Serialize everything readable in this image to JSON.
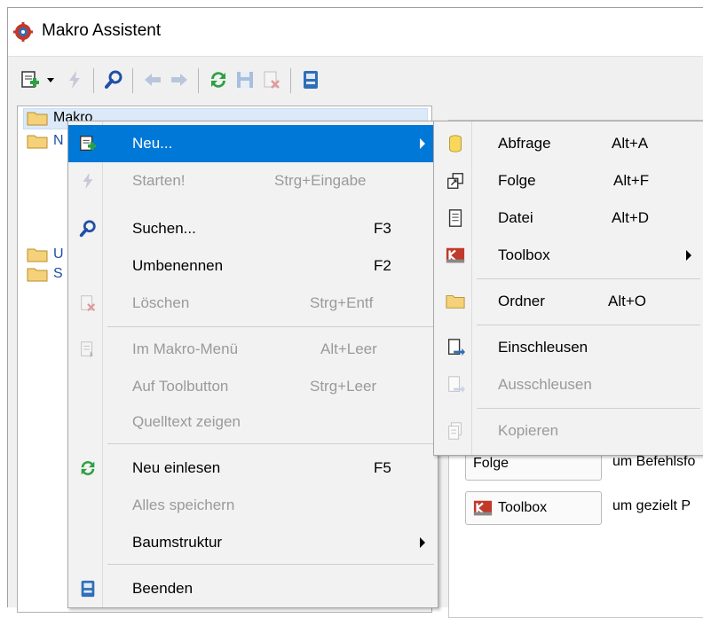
{
  "window": {
    "title": "Makro Assistent"
  },
  "tree": {
    "items": [
      {
        "label": "Makro"
      },
      {
        "label": "N"
      },
      {
        "label": "U"
      },
      {
        "label": "S"
      }
    ]
  },
  "context_menu": {
    "items": [
      {
        "label": "Neu...",
        "shortcut": "",
        "disabled": false,
        "submenu": true,
        "icon": "new-document-icon"
      },
      {
        "label": "Starten!",
        "shortcut": "Strg+Eingabe",
        "disabled": true,
        "icon": "lightning-icon"
      },
      {
        "label": "Suchen...",
        "shortcut": "F3",
        "disabled": false,
        "icon": "search-icon"
      },
      {
        "label": "Umbenennen",
        "shortcut": "F2",
        "disabled": false
      },
      {
        "label": "Löschen",
        "shortcut": "Strg+Entf",
        "disabled": true,
        "icon": "delete-icon"
      },
      {
        "label": "Im Makro-Menü",
        "shortcut": "Alt+Leer",
        "disabled": true,
        "icon": "menu-icon"
      },
      {
        "label": "Auf Toolbutton",
        "shortcut": "Strg+Leer",
        "disabled": true
      },
      {
        "label": "Quelltext zeigen",
        "shortcut": "",
        "disabled": true
      },
      {
        "label": "Neu einlesen",
        "shortcut": "F5",
        "disabled": false,
        "icon": "refresh-icon"
      },
      {
        "label": "Alles speichern",
        "shortcut": "",
        "disabled": true
      },
      {
        "label": "Baumstruktur",
        "shortcut": "",
        "disabled": false,
        "submenu": true
      },
      {
        "label": "Beenden",
        "shortcut": "",
        "disabled": false,
        "icon": "exit-icon"
      }
    ]
  },
  "submenu": {
    "items": [
      {
        "label": "Abfrage",
        "shortcut": "Alt+A",
        "disabled": false,
        "icon": "database-icon"
      },
      {
        "label": "Folge",
        "shortcut": "Alt+F",
        "disabled": false,
        "icon": "sequence-icon"
      },
      {
        "label": "Datei",
        "shortcut": "Alt+D",
        "disabled": false,
        "icon": "file-icon"
      },
      {
        "label": "Toolbox",
        "shortcut": "",
        "disabled": false,
        "submenu": true,
        "icon": "toolbox-icon"
      },
      {
        "label": "Ordner",
        "shortcut": "Alt+O",
        "disabled": false,
        "icon": "folder-icon"
      },
      {
        "label": "Einschleusen",
        "shortcut": "",
        "disabled": false,
        "icon": "import-icon"
      },
      {
        "label": "Ausschleusen",
        "shortcut": "",
        "disabled": true,
        "icon": "export-icon"
      },
      {
        "label": "Kopieren",
        "shortcut": "",
        "disabled": true,
        "icon": "copy-icon"
      }
    ]
  },
  "right_panel": {
    "buttons": [
      {
        "label": "Folge",
        "description": "um Befehlsfo"
      },
      {
        "label": "Toolbox",
        "description": "um gezielt P"
      }
    ]
  },
  "colors": {
    "highlight": "#0078d7",
    "disabled_text": "#9a9a9a",
    "menu_bg": "#f2f2f2"
  }
}
